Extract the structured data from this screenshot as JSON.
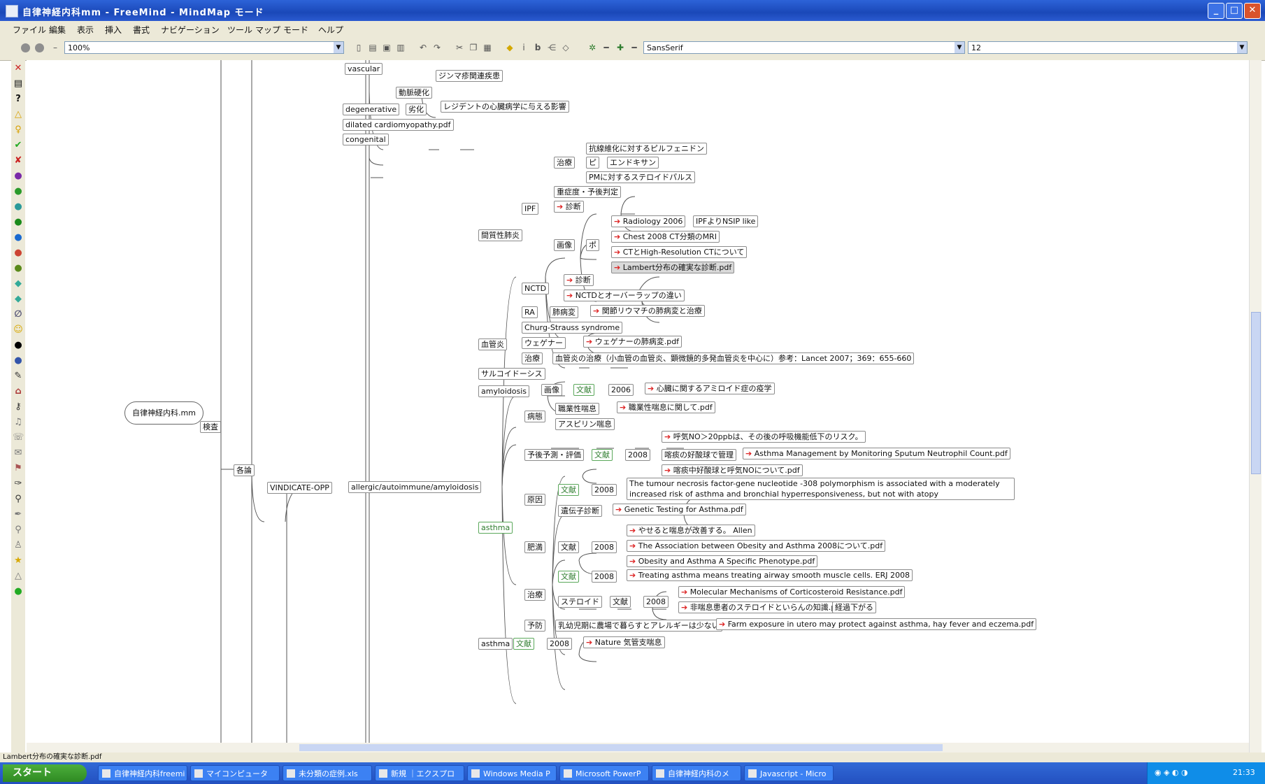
{
  "titlebar": {
    "title": "自律神経内科mm - FreeMind - MindMap モード",
    "min": "_",
    "max": "□",
    "close": "✕"
  },
  "menu": [
    "ファイル",
    "編集",
    "表示",
    "挿入",
    "書式",
    "ナビゲーション",
    "ツール",
    "マップ",
    "モード",
    "ヘルプ"
  ],
  "toolbar": {
    "zoom": "100%",
    "font": "SansSerif",
    "font_size": "12"
  },
  "mindmap": {
    "root": "自律神経内科.mm",
    "level1": "検査",
    "level2": "各論",
    "level3": "VINDICATE-OPP",
    "level4": "allergic/autoimmune/amyloidosis",
    "top_nodes": {
      "vascular": "vascular",
      "top_child": "ジンマ疹関連疾患",
      "kouka": "動脈硬化",
      "degenerative": "degenerative",
      "degenerative_child": "劣化",
      "degenerative_leaf": "レジデントの心臓病学に与える影響",
      "file1": "dilated cardiomyopathy.pdf",
      "congenital": "congenital"
    },
    "kanshitsu": {
      "label": "間質性肺炎",
      "ipf": "IPF",
      "treatment": "治療",
      "tx1": "抗線維化に対するピルフェニドン",
      "tx1b": "ピ",
      "tx1c": "エンドキサン",
      "tx2": "PMに対するステロイドパルス",
      "risk": "重症度・予後判定",
      "dx": "診断",
      "image": "画像",
      "image_child": "ポ",
      "ref1": "Radiology 2006",
      "ref1b": "IPFよりNSIP like",
      "ref2": "Chest 2008 CT分類のMRI",
      "ref3": "CTとHigh-Resolution CTについて",
      "ref4": "Lambert分布の確実な診断.pdf",
      "nctd": "NCTD",
      "nctd1": "診断",
      "nctd2": "NCTDとオーバーラップの違い",
      "ra": "RA",
      "ra1": "肺病変",
      "ra2": "関節リウマチの肺病変と治療"
    },
    "kekkan": {
      "label": "血管炎",
      "css": "Churg-Strauss syndrome",
      "wegener": "ウェゲナー",
      "wegener_file": "ウェゲナーの肺病変.pdf",
      "treat": "治療",
      "treat_text": "血管炎の治療（小血管の血管炎、顕微鏡的多発血管炎を中心に）参考：Lancet 2007；369：655-660"
    },
    "sarcoid": "サルコイドーシス",
    "amyloid": {
      "label": "amyloidosis",
      "dx": "画像",
      "rx": "文献",
      "year": "2006",
      "file": "心臓に関するアミロイド症の疫学"
    },
    "asthma": {
      "label": "asthma",
      "gen": "病態",
      "gen1": "職業性喘息",
      "gen2": "アスピリン喘息",
      "gen1_file": "職業性喘息に関して.pdf",
      "prog": "予後予測・評価",
      "prog_tag": "文献",
      "prog_year": "2008",
      "prog1": "呼気NO＞20ppbは、その後の呼吸機能低下のリスク。",
      "prog2": "喀痰の好酸球で管理",
      "prog2_file": "Asthma Management by Monitoring Sputum Neutrophil Count.pdf",
      "prog3": "喀痰中好酸球と呼気NOについて.pdf",
      "cause": "原因",
      "cause_tag": "文献",
      "cause_year": "2008",
      "cause_text": "The tumour necrosis factor-gene nucleotide -308 polymorphism is associated with a moderately increased risk of asthma and bronchial hyperresponsiveness, but not with atopy",
      "gene": "遺伝子診断",
      "gene_file": "Genetic Testing for Asthma.pdf",
      "obes": "肥満",
      "obes_tag": "文献",
      "obes_year": "2008",
      "obes1": "やせると喘息が改善する。 Allen",
      "obes2": "The Association between Obesity and Asthma 2008について.pdf",
      "obes3": "Obesity and Asthma A Specific Phenotype.pdf",
      "tx": "治療",
      "tx_tag": "文献",
      "tx_year": "2008",
      "tx1": "Treating asthma means treating airway smooth muscle cells. ERJ 2008",
      "steroid": "ステロイド",
      "steroid_tag": "文献",
      "steroid_year": "2008",
      "steroid1": "Molecular Mechanisms of Corticosteroid Resistance.pdf",
      "steroid2": "非喘息患者のステロイドといらんの知識.pdf",
      "steroid2b": "経過下がる",
      "other": "予防",
      "other1": "乳幼児期に農場で暮らすとアレルギーは少ない",
      "other1_file": "Farm exposure in utero may protect against asthma, hay fever and eczema.pdf",
      "bottom": "asthma",
      "bottom_tag": "文献",
      "bottom_year": "2008",
      "bottom_file": "Nature 気管支喘息"
    }
  },
  "statusbar": "Lambert分布の確実な診断.pdf",
  "taskbar": {
    "start": "スタート",
    "tasks": [
      "自律神経内科freemi",
      "マイコンピュータ",
      "未分類の症例.xls",
      "新規 ｜エクスプロ",
      "Windows Media P",
      "Microsoft PowerP",
      "自律神経内科のメ",
      "Javascript - Micro"
    ],
    "clock": "21:33"
  }
}
